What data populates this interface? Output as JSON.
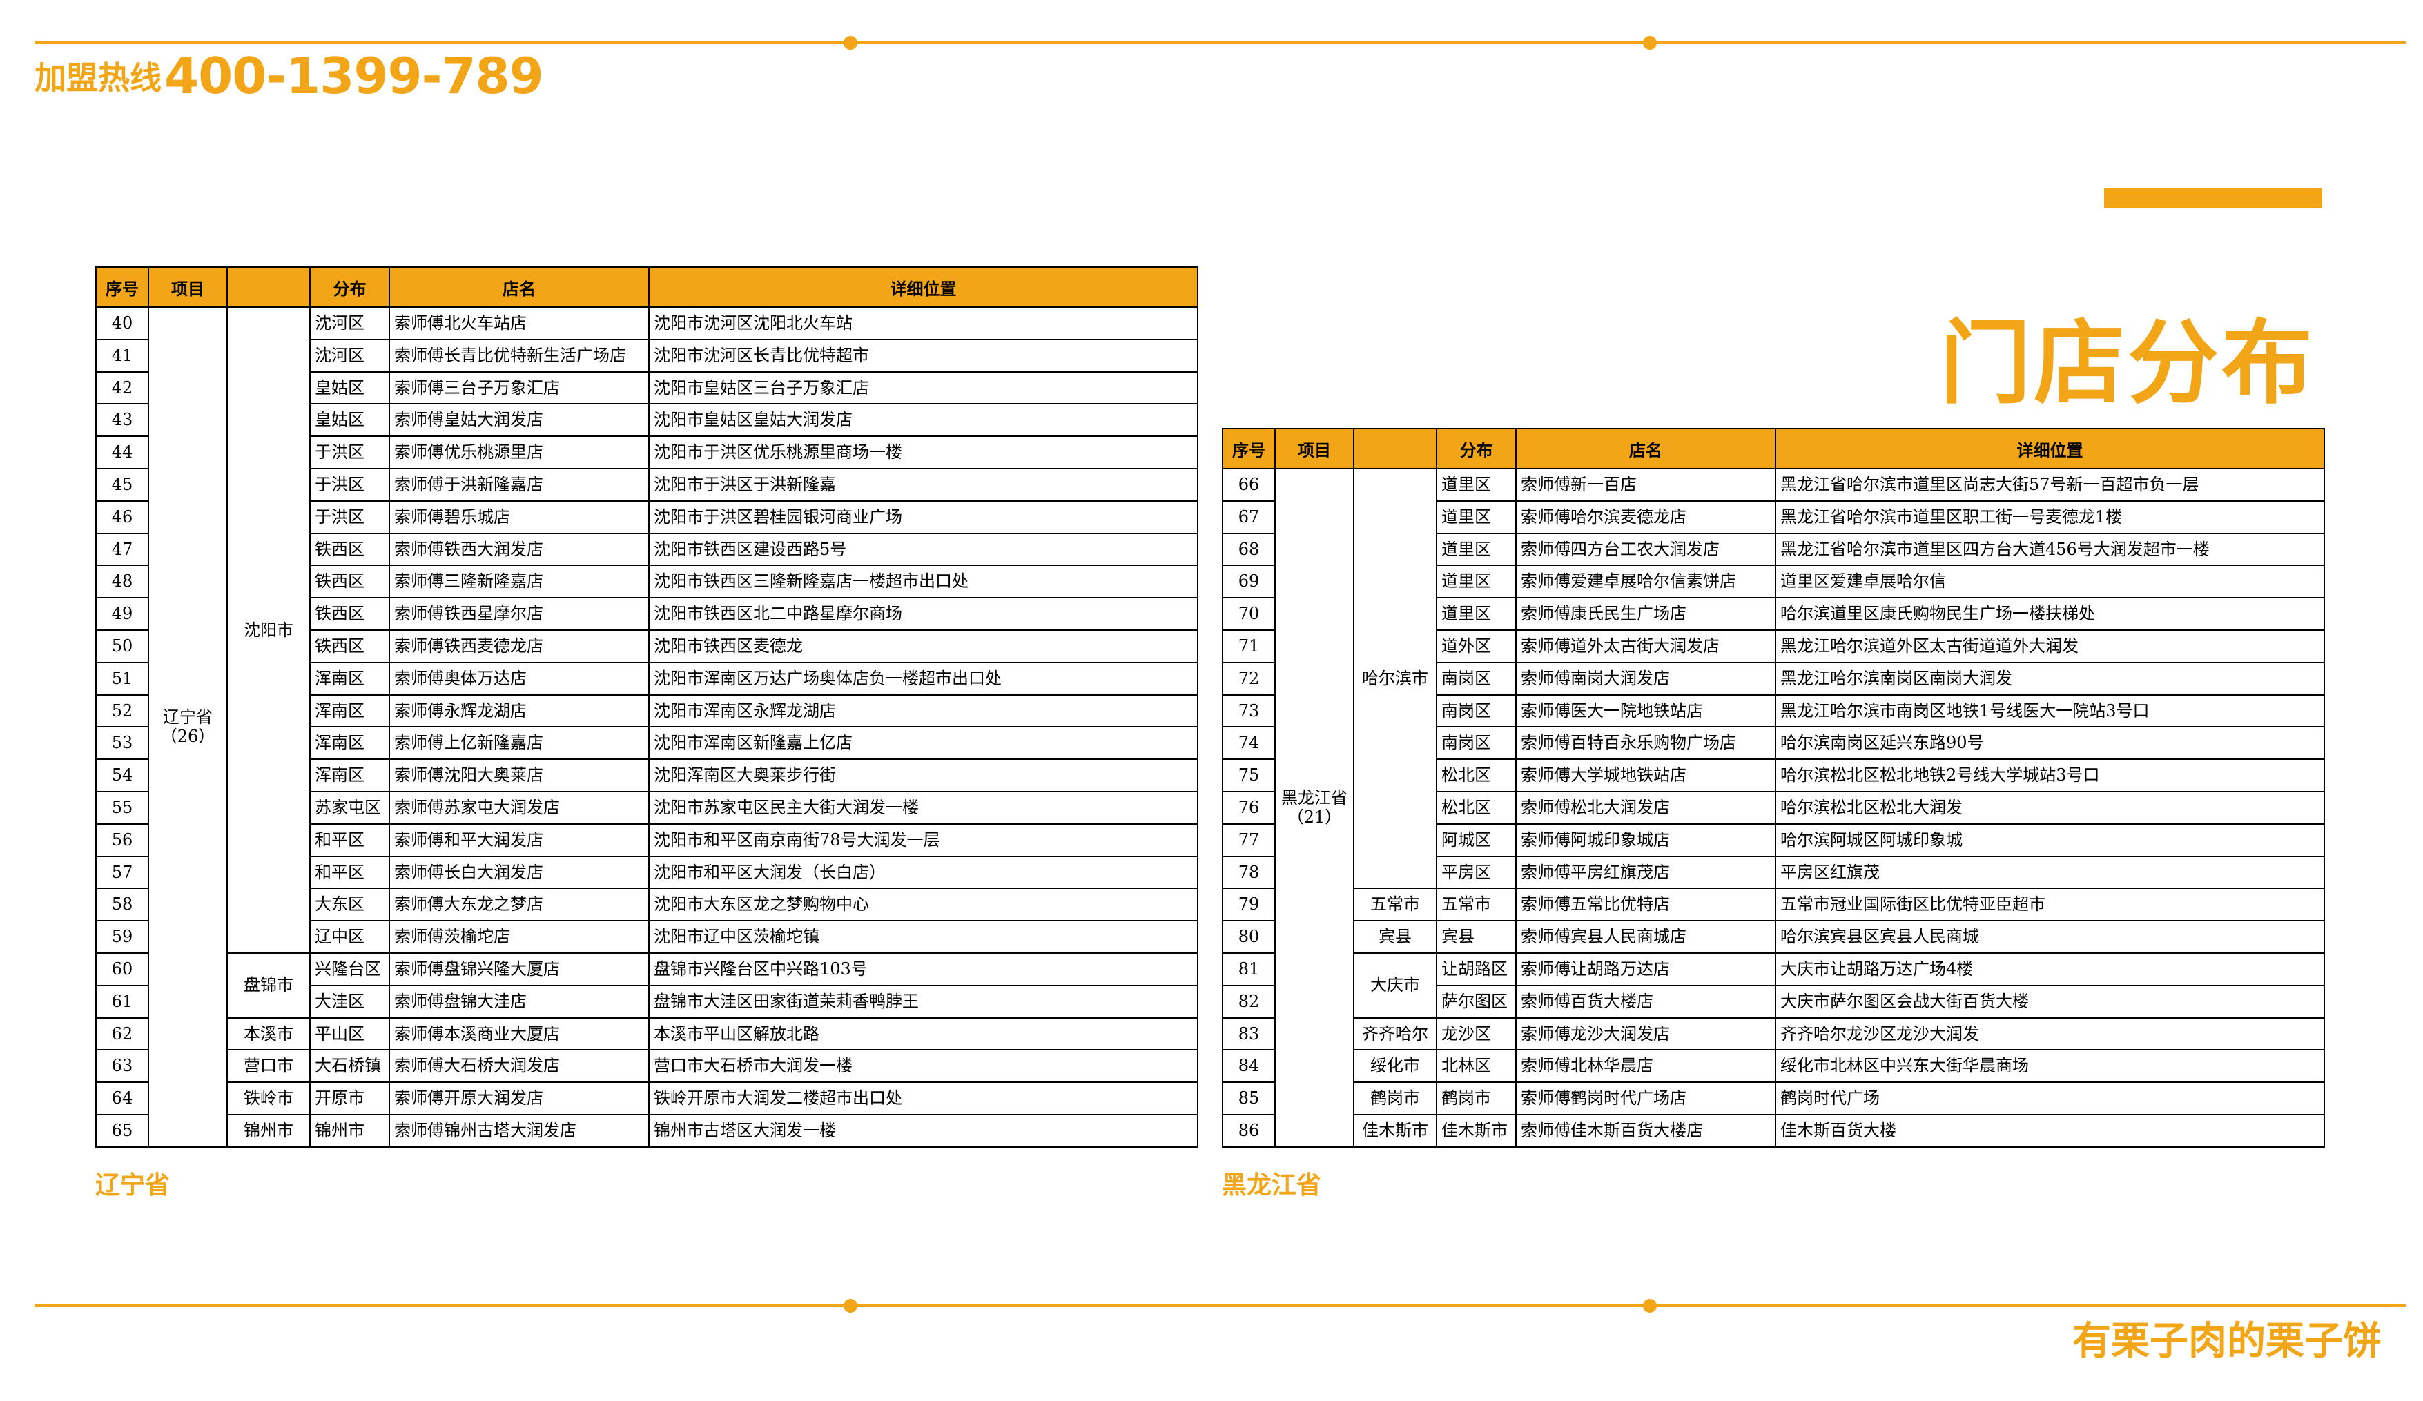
{
  "header": {
    "hotline_label": "加盟热线",
    "hotline_number": "400-1399-789"
  },
  "page_title": "门店分布",
  "footer": {
    "slogan": "有栗子肉的栗子饼"
  },
  "colors": {
    "accent": "#f2a516",
    "border": "#000000",
    "background": "#ffffff"
  },
  "tables": {
    "left": {
      "province_label": "辽宁省",
      "columns": [
        "序号",
        "项目",
        "",
        "分布",
        "店名",
        "详细位置"
      ],
      "province": {
        "name": "辽宁省",
        "count": "（26）"
      },
      "cities": [
        {
          "name": "沈阳市",
          "rowspan": 20
        },
        {
          "name": "盘锦市",
          "rowspan": 2
        },
        {
          "name": "本溪市",
          "rowspan": 1
        },
        {
          "name": "营口市",
          "rowspan": 1
        },
        {
          "name": "铁岭市",
          "rowspan": 1
        },
        {
          "name": "锦州市",
          "rowspan": 1
        }
      ],
      "rows": [
        {
          "no": "40",
          "district": "沈河区",
          "store": "索师傅北火车站店",
          "address": "沈阳市沈河区沈阳北火车站"
        },
        {
          "no": "41",
          "district": "沈河区",
          "store": "索师傅长青比优特新生活广场店",
          "address": "沈阳市沈河区长青比优特超市"
        },
        {
          "no": "42",
          "district": "皇姑区",
          "store": "索师傅三台子万象汇店",
          "address": "沈阳市皇姑区三台子万象汇店"
        },
        {
          "no": "43",
          "district": "皇姑区",
          "store": "索师傅皇姑大润发店",
          "address": "沈阳市皇姑区皇姑大润发店"
        },
        {
          "no": "44",
          "district": "于洪区",
          "store": "索师傅优乐桃源里店",
          "address": "沈阳市于洪区优乐桃源里商场一楼"
        },
        {
          "no": "45",
          "district": "于洪区",
          "store": "索师傅于洪新隆嘉店",
          "address": "沈阳市于洪区于洪新隆嘉"
        },
        {
          "no": "46",
          "district": "于洪区",
          "store": "索师傅碧乐城店",
          "address": "沈阳市于洪区碧桂园银河商业广场"
        },
        {
          "no": "47",
          "district": "铁西区",
          "store": "索师傅铁西大润发店",
          "address": "沈阳市铁西区建设西路5号"
        },
        {
          "no": "48",
          "district": "铁西区",
          "store": "索师傅三隆新隆嘉店",
          "address": "沈阳市铁西区三隆新隆嘉店一楼超市出口处"
        },
        {
          "no": "49",
          "district": "铁西区",
          "store": "索师傅铁西星摩尔店",
          "address": "沈阳市铁西区北二中路星摩尔商场"
        },
        {
          "no": "50",
          "district": "铁西区",
          "store": "索师傅铁西麦德龙店",
          "address": "沈阳市铁西区麦德龙"
        },
        {
          "no": "51",
          "district": "浑南区",
          "store": "索师傅奥体万达店",
          "address": "沈阳市浑南区万达广场奥体店负一楼超市出口处"
        },
        {
          "no": "52",
          "district": "浑南区",
          "store": "索师傅永辉龙湖店",
          "address": "沈阳市浑南区永辉龙湖店"
        },
        {
          "no": "53",
          "district": "浑南区",
          "store": "索师傅上亿新隆嘉店",
          "address": "沈阳市浑南区新隆嘉上亿店"
        },
        {
          "no": "54",
          "district": "浑南区",
          "store": "索师傅沈阳大奥莱店",
          "address": "沈阳浑南区大奥莱步行街"
        },
        {
          "no": "55",
          "district": "苏家屯区",
          "store": "索师傅苏家屯大润发店",
          "address": "沈阳市苏家屯区民主大街大润发一楼"
        },
        {
          "no": "56",
          "district": "和平区",
          "store": "索师傅和平大润发店",
          "address": "沈阳市和平区南京南街78号大润发一层"
        },
        {
          "no": "57",
          "district": "和平区",
          "store": "索师傅长白大润发店",
          "address": "沈阳市和平区大润发（长白店）"
        },
        {
          "no": "58",
          "district": "大东区",
          "store": "索师傅大东龙之梦店",
          "address": "沈阳市大东区龙之梦购物中心"
        },
        {
          "no": "59",
          "district": "辽中区",
          "store": "索师傅茨榆坨店",
          "address": "沈阳市辽中区茨榆坨镇"
        },
        {
          "no": "60",
          "district": "兴隆台区",
          "store": "索师傅盘锦兴隆大厦店",
          "address": "盘锦市兴隆台区中兴路103号"
        },
        {
          "no": "61",
          "district": "大洼区",
          "store": "索师傅盘锦大洼店",
          "address": "盘锦市大洼区田家街道茉莉香鸭脖王"
        },
        {
          "no": "62",
          "district": "平山区",
          "store": "索师傅本溪商业大厦店",
          "address": "本溪市平山区解放北路"
        },
        {
          "no": "63",
          "district": "大石桥镇",
          "store": "索师傅大石桥大润发店",
          "address": "营口市大石桥市大润发一楼"
        },
        {
          "no": "64",
          "district": "开原市",
          "store": "索师傅开原大润发店",
          "address": "铁岭开原市大润发二楼超市出口处"
        },
        {
          "no": "65",
          "district": "锦州市",
          "store": "索师傅锦州古塔大润发店",
          "address": "锦州市古塔区大润发一楼"
        }
      ]
    },
    "right": {
      "province_label": "黑龙江省",
      "columns": [
        "序号",
        "项目",
        "",
        "分布",
        "店名",
        "详细位置"
      ],
      "province": {
        "name": "黑龙江省",
        "count": "（21）"
      },
      "cities": [
        {
          "name": "哈尔滨市",
          "rowspan": 13
        },
        {
          "name": "五常市",
          "rowspan": 1
        },
        {
          "name": "宾县",
          "rowspan": 1
        },
        {
          "name": "大庆市",
          "rowspan": 2
        },
        {
          "name": "齐齐哈尔",
          "rowspan": 1
        },
        {
          "name": "绥化市",
          "rowspan": 1
        },
        {
          "name": "鹤岗市",
          "rowspan": 1
        },
        {
          "name": "佳木斯市",
          "rowspan": 1
        }
      ],
      "rows": [
        {
          "no": "66",
          "district": "道里区",
          "store": "索师傅新一百店",
          "address": "黑龙江省哈尔滨市道里区尚志大街57号新一百超市负一层"
        },
        {
          "no": "67",
          "district": "道里区",
          "store": "索师傅哈尔滨麦德龙店",
          "address": "黑龙江省哈尔滨市道里区职工街一号麦德龙1楼"
        },
        {
          "no": "68",
          "district": "道里区",
          "store": "索师傅四方台工农大润发店",
          "address": "黑龙江省哈尔滨市道里区四方台大道456号大润发超市一楼"
        },
        {
          "no": "69",
          "district": "道里区",
          "store": "索师傅爱建卓展哈尔信素饼店",
          "address": "道里区爱建卓展哈尔信"
        },
        {
          "no": "70",
          "district": "道里区",
          "store": "索师傅康氏民生广场店",
          "address": "哈尔滨道里区康氏购物民生广场一楼扶梯处"
        },
        {
          "no": "71",
          "district": "道外区",
          "store": "索师傅道外太古街大润发店",
          "address": "黑龙江哈尔滨道外区太古街道道外大润发"
        },
        {
          "no": "72",
          "district": "南岗区",
          "store": "索师傅南岗大润发店",
          "address": "黑龙江哈尔滨南岗区南岗大润发"
        },
        {
          "no": "73",
          "district": "南岗区",
          "store": "索师傅医大一院地铁站店",
          "address": "黑龙江哈尔滨市南岗区地铁1号线医大一院站3号口"
        },
        {
          "no": "74",
          "district": "南岗区",
          "store": "索师傅百特百永乐购物广场店",
          "address": "哈尔滨南岗区延兴东路90号"
        },
        {
          "no": "75",
          "district": "松北区",
          "store": "索师傅大学城地铁站店",
          "address": "哈尔滨松北区松北地铁2号线大学城站3号口"
        },
        {
          "no": "76",
          "district": "松北区",
          "store": "索师傅松北大润发店",
          "address": "哈尔滨松北区松北大润发"
        },
        {
          "no": "77",
          "district": "阿城区",
          "store": "索师傅阿城印象城店",
          "address": "哈尔滨阿城区阿城印象城"
        },
        {
          "no": "78",
          "district": "平房区",
          "store": "索师傅平房红旗茂店",
          "address": "平房区红旗茂"
        },
        {
          "no": "79",
          "district": "五常市",
          "store": "索师傅五常比优特店",
          "address": "五常市冠业国际街区比优特亚臣超市"
        },
        {
          "no": "80",
          "district": "宾县",
          "store": "索师傅宾县人民商城店",
          "address": "哈尔滨宾县区宾县人民商城"
        },
        {
          "no": "81",
          "district": "让胡路区",
          "store": "索师傅让胡路万达店",
          "address": "大庆市让胡路万达广场4楼"
        },
        {
          "no": "82",
          "district": "萨尔图区",
          "store": "索师傅百货大楼店",
          "address": "大庆市萨尔图区会战大街百货大楼"
        },
        {
          "no": "83",
          "district": "龙沙区",
          "store": "索师傅龙沙大润发店",
          "address": "齐齐哈尔龙沙区龙沙大润发"
        },
        {
          "no": "84",
          "district": "北林区",
          "store": "索师傅北林华晨店",
          "address": "绥化市北林区中兴东大街华晨商场"
        },
        {
          "no": "85",
          "district": "鹤岗市",
          "store": "索师傅鹤岗时代广场店",
          "address": "鹤岗时代广场"
        },
        {
          "no": "86",
          "district": "佳木斯市",
          "store": "索师傅佳木斯百货大楼店",
          "address": "佳木斯百货大楼"
        }
      ]
    }
  }
}
